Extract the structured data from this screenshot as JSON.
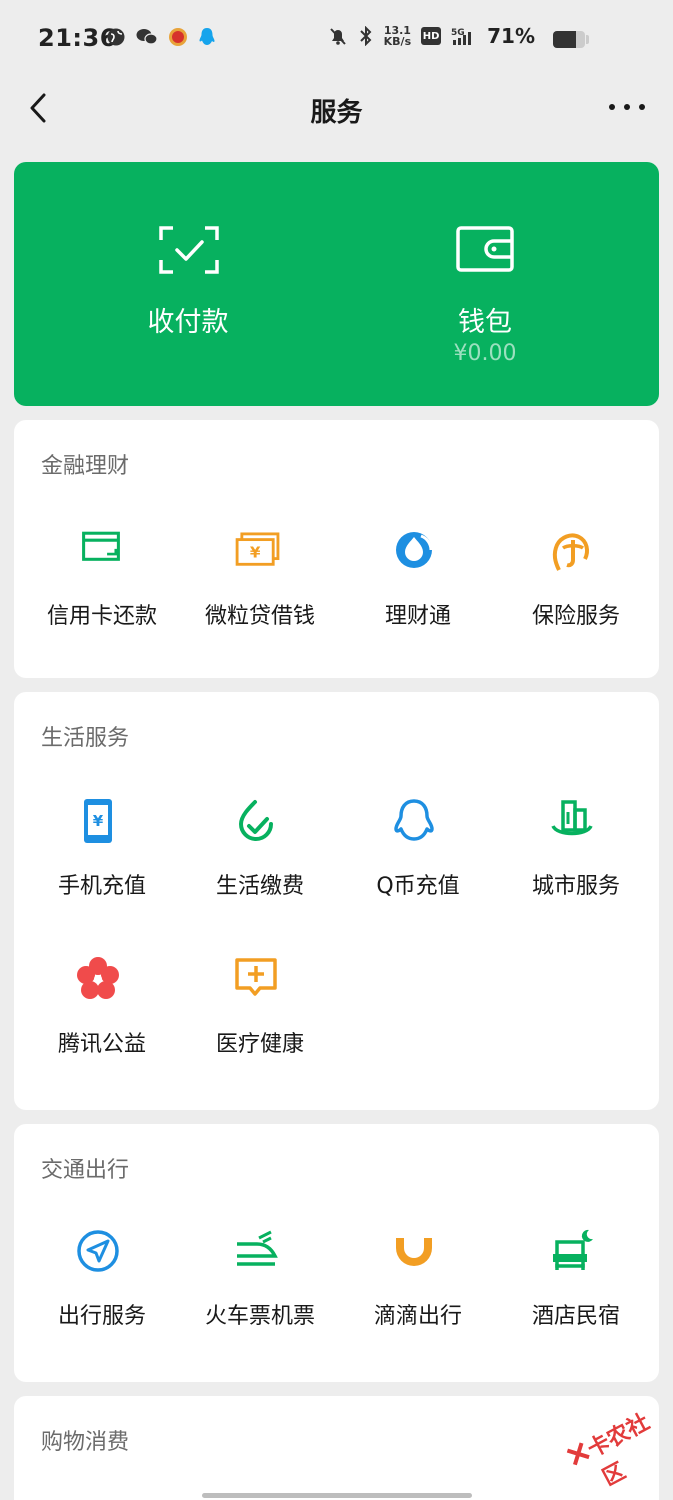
{
  "status_bar": {
    "time": "21:36",
    "speed_top": "13.1",
    "speed_bottom": "KB/s",
    "hd": "HD",
    "network": "5G",
    "battery_percent": "71%",
    "battery_level": 0.71
  },
  "nav": {
    "title": "服务"
  },
  "top_card": {
    "pay_label": "收付款",
    "wallet_label": "钱包",
    "wallet_balance": "¥0.00",
    "background": "#07b15f"
  },
  "finance": {
    "title": "金融理财",
    "items": [
      {
        "label": "信用卡还款",
        "icon": "credit-card-icon",
        "color": "#07b15f"
      },
      {
        "label": "微粒贷借钱",
        "icon": "loan-icon",
        "color": "#f29e23"
      },
      {
        "label": "理财通",
        "icon": "wealth-icon",
        "color": "#1e8fe1"
      },
      {
        "label": "保险服务",
        "icon": "insurance-icon",
        "color": "#f29e23"
      }
    ]
  },
  "life": {
    "title": "生活服务",
    "items": [
      {
        "label": "手机充值",
        "icon": "phone-recharge-icon",
        "color": "#1e8fe1"
      },
      {
        "label": "生活缴费",
        "icon": "utility-bill-icon",
        "color": "#07b15f"
      },
      {
        "label": "Q币充值",
        "icon": "qq-coin-icon",
        "color": "#1e8fe1"
      },
      {
        "label": "城市服务",
        "icon": "city-service-icon",
        "color": "#07b15f"
      },
      {
        "label": "腾讯公益",
        "icon": "charity-flower-icon",
        "color": "#f04b4b"
      },
      {
        "label": "医疗健康",
        "icon": "medical-health-icon",
        "color": "#f29e23"
      }
    ]
  },
  "travel": {
    "title": "交通出行",
    "items": [
      {
        "label": "出行服务",
        "icon": "travel-navigation-icon",
        "color": "#1e8fe1"
      },
      {
        "label": "火车票机票",
        "icon": "train-plane-ticket-icon",
        "color": "#07b15f"
      },
      {
        "label": "滴滴出行",
        "icon": "didi-icon",
        "color": "#f29e23"
      },
      {
        "label": "酒店民宿",
        "icon": "hotel-bed-icon",
        "color": "#07b15f"
      }
    ]
  },
  "shopping": {
    "title": "购物消费"
  },
  "watermark": {
    "text": "卡农社区"
  }
}
